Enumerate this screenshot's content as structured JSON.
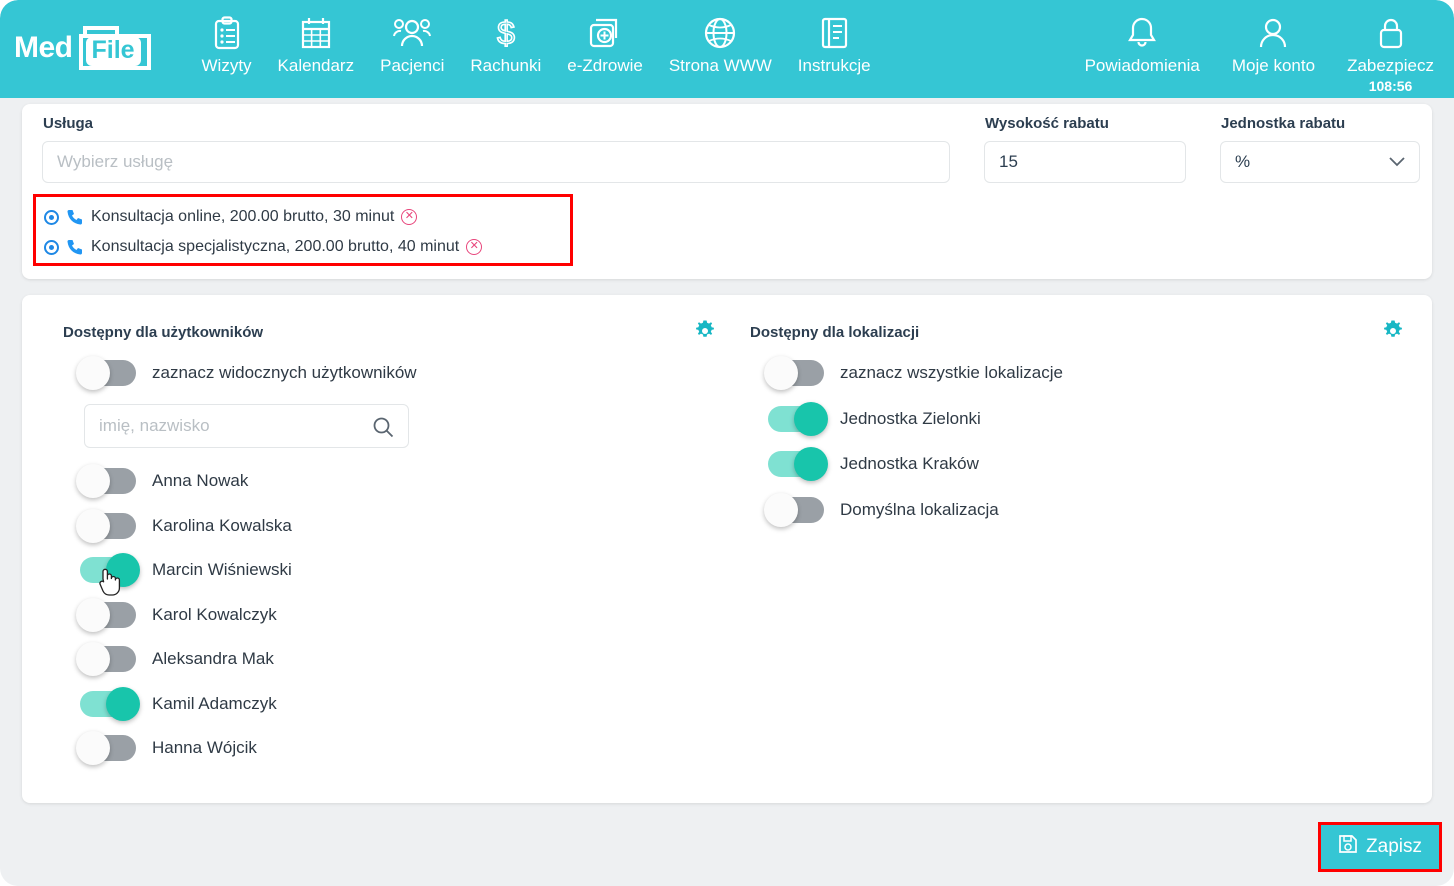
{
  "brand": {
    "med": "Med",
    "file": "File"
  },
  "nav": {
    "items": [
      {
        "label": "Wizyty",
        "icon": "clipboard-icon"
      },
      {
        "label": "Kalendarz",
        "icon": "calendar-icon"
      },
      {
        "label": "Pacjenci",
        "icon": "people-icon"
      },
      {
        "label": "Rachunki",
        "icon": "dollar-icon"
      },
      {
        "label": "e-Zdrowie",
        "icon": "medical-card-icon"
      },
      {
        "label": "Strona WWW",
        "icon": "globe-icon"
      },
      {
        "label": "Instrukcje",
        "icon": "book-icon"
      }
    ],
    "right": [
      {
        "label": "Powiadomienia",
        "icon": "bell-icon"
      },
      {
        "label": "Moje konto",
        "icon": "user-icon"
      },
      {
        "label": "Zabezpiecz",
        "icon": "lock-icon",
        "timer": "108:56"
      }
    ]
  },
  "service_card": {
    "service_label": "Usługa",
    "service_placeholder": "Wybierz usługę",
    "service_value": "",
    "discount_amount_label": "Wysokość rabatu",
    "discount_amount_value": "15",
    "discount_unit_label": "Jednostka rabatu",
    "discount_unit_value": "%",
    "selected_services": [
      {
        "text": "Konsultacja online, 200.00 brutto, 30 minut",
        "selected": true,
        "type": "phone"
      },
      {
        "text": "Konsultacja specjalistyczna, 200.00 brutto, 40 minut",
        "selected": true,
        "type": "phone"
      }
    ]
  },
  "availability": {
    "users": {
      "title": "Dostępny dla użytkowników",
      "select_all_label": "zaznacz widocznych użytkowników",
      "select_all_on": false,
      "search_placeholder": "imię, nazwisko",
      "search_value": "",
      "list": [
        {
          "name": "Anna Nowak",
          "on": false
        },
        {
          "name": "Karolina Kowalska",
          "on": false
        },
        {
          "name": "Marcin Wiśniewski",
          "on": true
        },
        {
          "name": "Karol Kowalczyk",
          "on": false
        },
        {
          "name": "Aleksandra Mak",
          "on": false
        },
        {
          "name": "Kamil Adamczyk",
          "on": true
        },
        {
          "name": "Hanna Wójcik",
          "on": false
        }
      ]
    },
    "locations": {
      "title": "Dostępny dla lokalizacji",
      "select_all_label": "zaznacz wszystkie lokalizacje",
      "select_all_on": false,
      "list": [
        {
          "name": "Jednostka Zielonki",
          "on": true
        },
        {
          "name": "Jednostka Kraków",
          "on": true
        },
        {
          "name": "Domyślna lokalizacja",
          "on": false
        }
      ]
    }
  },
  "footer": {
    "save_label": "Zapisz"
  },
  "colors": {
    "brand_teal": "#35c6d4",
    "toggle_on_track": "#7fe1d2",
    "toggle_on_knob": "#18c5ab",
    "toggle_off": "#9aa0a6",
    "highlight_red": "#ff0000",
    "radio_blue": "#1e88e5",
    "remove_pink": "#e8467c",
    "page_bg": "#eef0f2"
  }
}
